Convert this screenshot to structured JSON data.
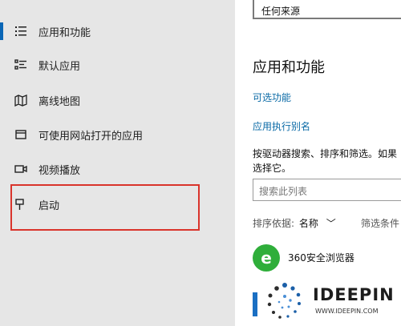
{
  "sidebar": {
    "items": [
      {
        "label": "应用和功能",
        "icon": "apps-list-icon"
      },
      {
        "label": "默认应用",
        "icon": "default-apps-icon"
      },
      {
        "label": "离线地图",
        "icon": "map-icon"
      },
      {
        "label": "可使用网站打开的应用",
        "icon": "website-apps-icon"
      },
      {
        "label": "视频播放",
        "icon": "video-icon"
      },
      {
        "label": "启动",
        "icon": "startup-icon"
      }
    ],
    "highlight_color": "#d9342b",
    "selection_color": "#0a66b6"
  },
  "main": {
    "source_dropdown_value": "任何来源",
    "heading": "应用和功能",
    "optional_features_link": "可选功能",
    "app_alias_link": "应用执行别名",
    "description": "按驱动器搜索、排序和筛选。如果 选择它。",
    "search_placeholder": "搜索此列表",
    "sort_label": "排序依据:",
    "sort_value": "名称",
    "filter_label": "筛选条件",
    "apps": [
      {
        "name": "360安全浏览器",
        "icon": "360-browser-icon"
      }
    ]
  },
  "watermark": {
    "brand": "IDEEPIN",
    "url": "WWW.IDEEPIN.COM"
  }
}
